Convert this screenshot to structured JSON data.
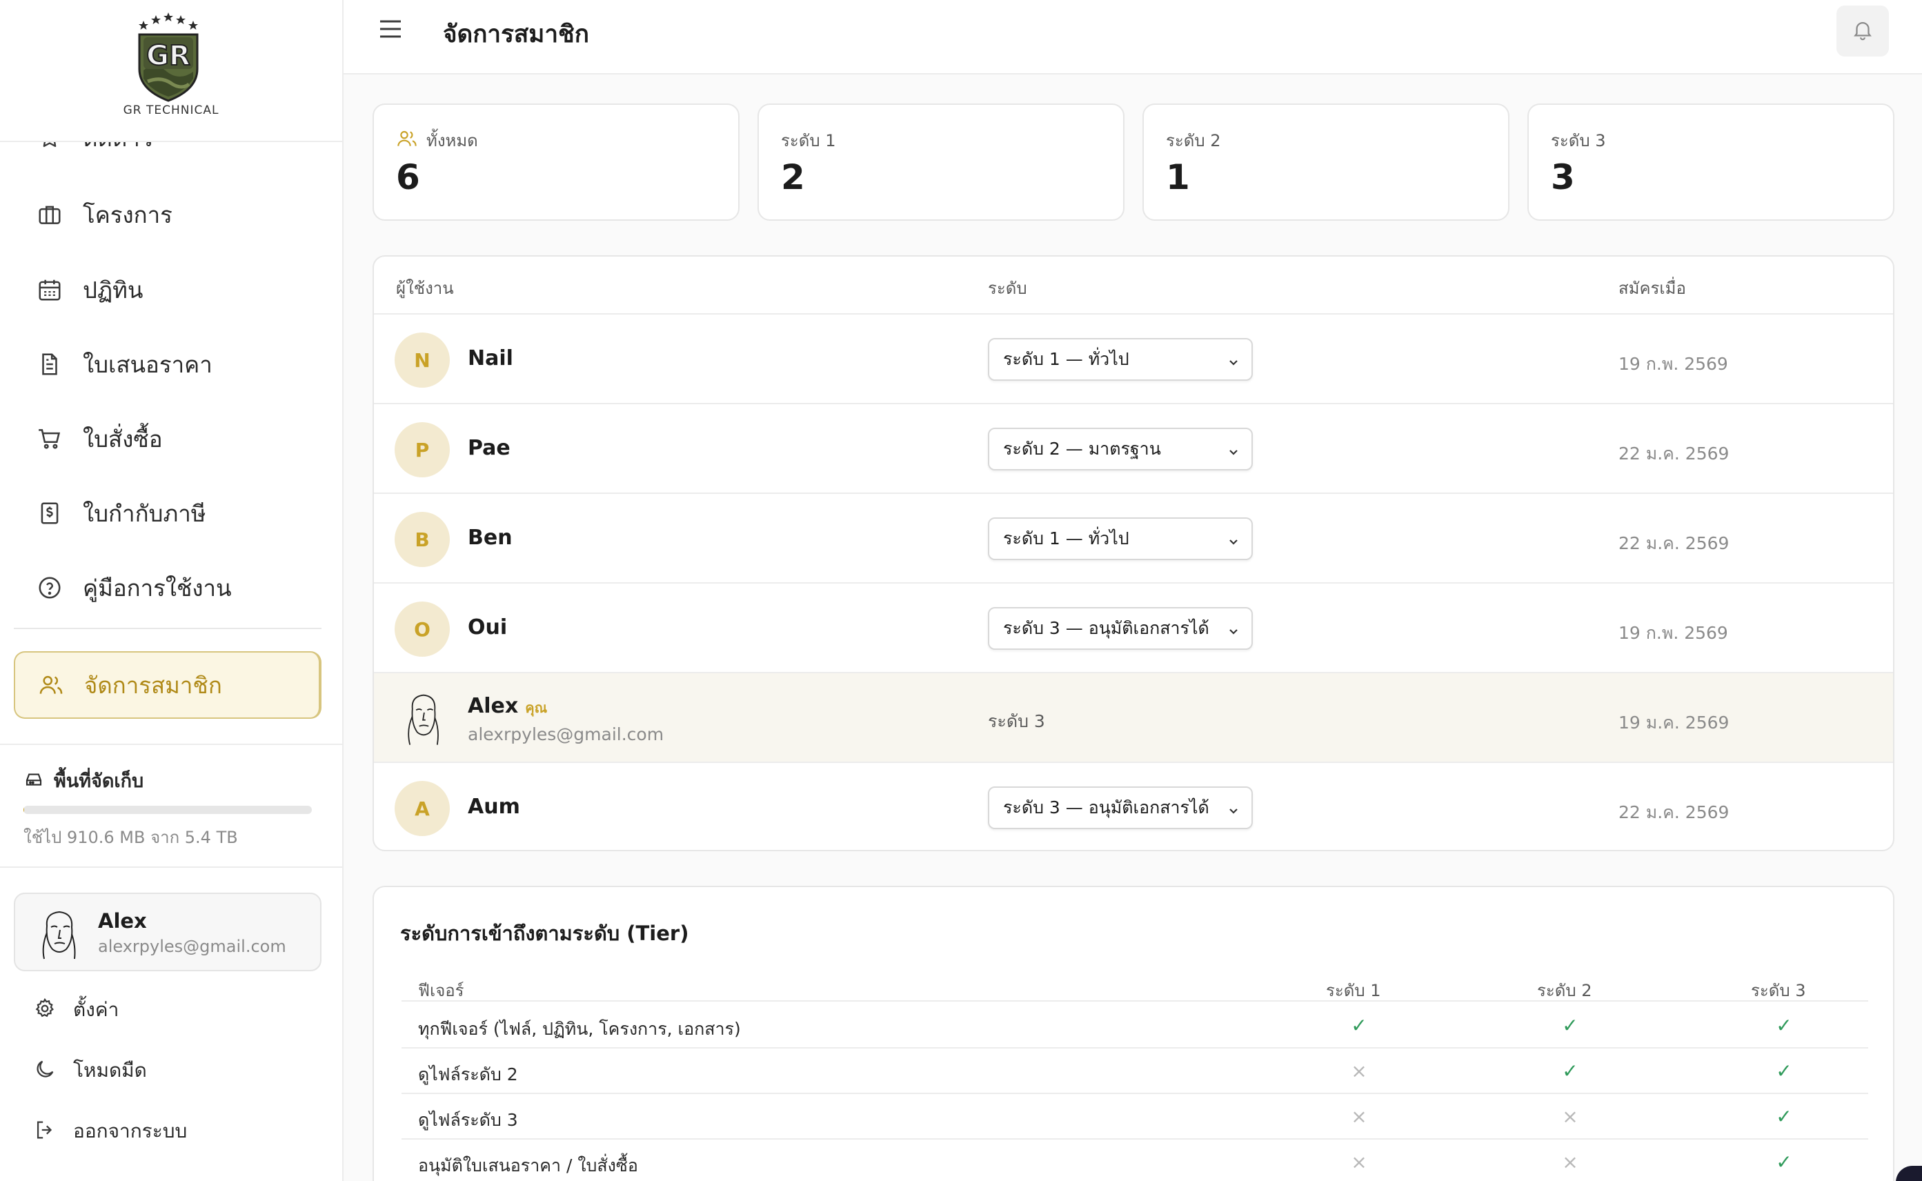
{
  "brand": {
    "logo_letters": "GR",
    "name": "GR TECHNICAL"
  },
  "sidebar": {
    "items": [
      {
        "label": "ติดดาว",
        "icon": "star-icon"
      },
      {
        "label": "โครงการ",
        "icon": "briefcase-icon"
      },
      {
        "label": "ปฏิทิน",
        "icon": "calendar-icon"
      },
      {
        "label": "ใบเสนอราคา",
        "icon": "document-icon"
      },
      {
        "label": "ใบสั่งซื้อ",
        "icon": "cart-icon"
      },
      {
        "label": "ใบกำกับภาษี",
        "icon": "receipt-dollar-icon"
      },
      {
        "label": "คู่มือการใช้งาน",
        "icon": "help-circle-icon"
      },
      {
        "label": "จัดการสมาชิก",
        "icon": "users-icon",
        "active": true
      }
    ],
    "storage": {
      "title": "พื้นที่จัดเก็บ",
      "text": "ใช้ไป 910.6 MB จาก 5.4 TB",
      "used_fraction": 0.0002
    },
    "user": {
      "name": "Alex",
      "email": "alexrpyles@gmail.com"
    },
    "footer": [
      {
        "label": "ตั้งค่า",
        "icon": "gear-icon"
      },
      {
        "label": "โหมดมืด",
        "icon": "moon-icon"
      },
      {
        "label": "ออกจากระบบ",
        "icon": "logout-icon"
      }
    ]
  },
  "header": {
    "title": "จัดการสมาชิก"
  },
  "stats": [
    {
      "label": "ทั้งหมด",
      "value": "6"
    },
    {
      "label": "ระดับ 1",
      "value": "2"
    },
    {
      "label": "ระดับ 2",
      "value": "1"
    },
    {
      "label": "ระดับ 3",
      "value": "3"
    }
  ],
  "members": {
    "columns": [
      "ผู้ใช้งาน",
      "ระดับ",
      "สมัครเมื่อ"
    ],
    "rows": [
      {
        "initial": "N",
        "name": "Nail",
        "level": "ระดับ 1 — ทั่วไป",
        "date": "19 ก.พ. 2569"
      },
      {
        "initial": "P",
        "name": "Pae",
        "level": "ระดับ 2 — มาตรฐาน",
        "date": "22 ม.ค. 2569"
      },
      {
        "initial": "B",
        "name": "Ben",
        "level": "ระดับ 1 — ทั่วไป",
        "date": "22 ม.ค. 2569"
      },
      {
        "initial": "O",
        "name": "Oui",
        "level": "ระดับ 3 — อนุมัติเอกสารได้",
        "date": "19 ก.พ. 2569"
      },
      {
        "name": "Alex",
        "you": "คุณ",
        "email": "alexrpyles@gmail.com",
        "level": "ระดับ 3",
        "date": "19 ม.ค. 2569"
      },
      {
        "initial": "A",
        "name": "Aum",
        "level": "ระดับ 3 — อนุมัติเอกสารได้",
        "date": "22 ม.ค. 2569"
      }
    ]
  },
  "tiers": {
    "title": "ระดับการเข้าถึงตามระดับ (Tier)",
    "columns": [
      "ฟีเจอร์",
      "ระดับ 1",
      "ระดับ 2",
      "ระดับ 3"
    ],
    "rows": [
      {
        "feature": "ทุกฟีเจอร์ (ไฟล์, ปฏิทิน, โครงการ, เอกสาร)",
        "t1": "✓",
        "t2": "✓",
        "t3": "✓"
      },
      {
        "feature": "ดูไฟล์ระดับ 2",
        "t1": "×",
        "t2": "✓",
        "t3": "✓"
      },
      {
        "feature": "ดูไฟล์ระดับ 3",
        "t1": "×",
        "t2": "×",
        "t3": "✓"
      },
      {
        "feature": "อนุมัติใบเสนอราคา / ใบสั่งซื้อ",
        "t1": "×",
        "t2": "×",
        "t3": "✓"
      }
    ]
  },
  "colors": {
    "accent": "#c9a227",
    "check": "#2f9a5a",
    "cross": "#b8b8b8"
  }
}
